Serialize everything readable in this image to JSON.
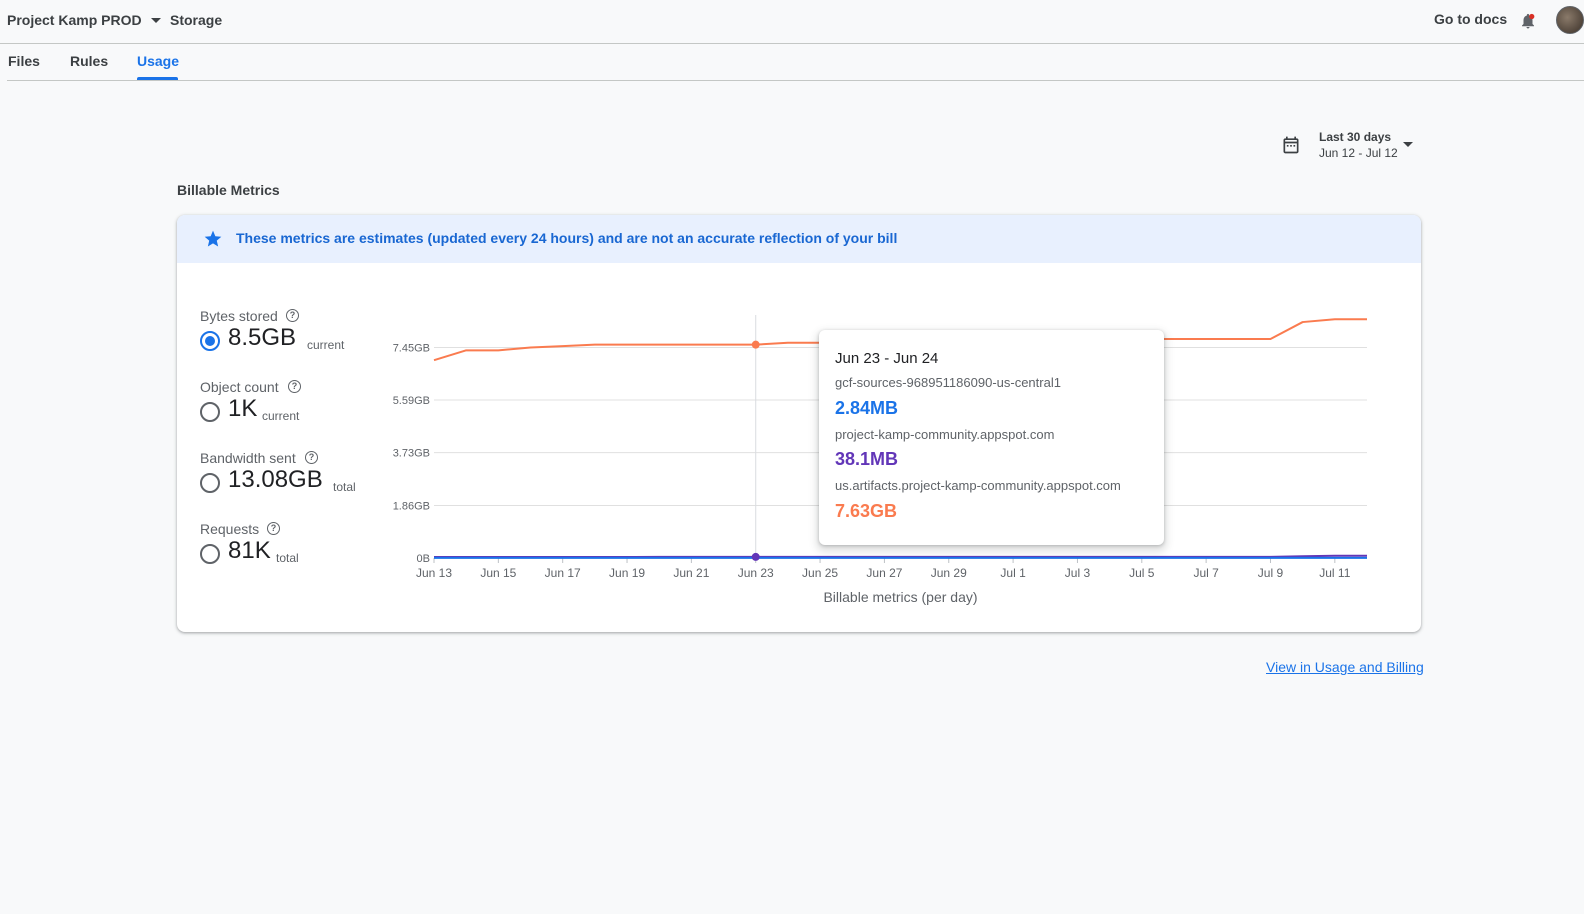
{
  "header": {
    "project_name": "Project Kamp PROD",
    "product": "Storage",
    "docs_link": "Go to docs",
    "icons": [
      "chevron-down-icon",
      "bell-icon",
      "avatar"
    ]
  },
  "tabs": [
    {
      "label": "Files"
    },
    {
      "label": "Rules"
    },
    {
      "label": "Usage",
      "active": true
    }
  ],
  "date_range": {
    "title": "Last 30 days",
    "range": "Jun 12 - Jul 12"
  },
  "section_title": "Billable Metrics",
  "banner": {
    "text": "These metrics are estimates (updated every 24 hours) and are not an accurate reflection of your bill"
  },
  "metrics": [
    {
      "label": "Bytes stored",
      "value": "8.5GB",
      "suffix": "current",
      "selected": true
    },
    {
      "label": "Object count",
      "value": "1K",
      "suffix": "current",
      "selected": false
    },
    {
      "label": "Bandwidth sent",
      "value": "13.08GB",
      "suffix": "total",
      "selected": false
    },
    {
      "label": "Requests",
      "value": "81K",
      "suffix": "total",
      "selected": false
    }
  ],
  "colors": {
    "accent": "#1a73e8",
    "series_orange": "#fa7b4f",
    "series_purple": "#6236b8",
    "series_blue": "#1a73e8"
  },
  "chart_data": {
    "type": "line",
    "xlabel": "Billable metrics (per day)",
    "ylabel": "",
    "y_tick_labels": [
      "0B",
      "1.86GB",
      "3.73GB",
      "5.59GB",
      "7.45GB"
    ],
    "y_ticks_gb": [
      0,
      1.86,
      3.73,
      5.59,
      7.45
    ],
    "ylim_gb": [
      0,
      8.6
    ],
    "x_tick_labels": [
      "Jun 13",
      "Jun 15",
      "Jun 17",
      "Jun 19",
      "Jun 21",
      "Jun 23",
      "Jun 25",
      "Jun 27",
      "Jun 29",
      "Jul 1",
      "Jul 3",
      "Jul 5",
      "Jul 7",
      "Jul 9",
      "Jul 11"
    ],
    "x": [
      "Jun 13",
      "Jun 14",
      "Jun 15",
      "Jun 16",
      "Jun 17",
      "Jun 18",
      "Jun 19",
      "Jun 20",
      "Jun 21",
      "Jun 22",
      "Jun 23",
      "Jun 24",
      "Jun 25",
      "Jun 26",
      "Jun 27",
      "Jun 28",
      "Jun 29",
      "Jun 30",
      "Jul 1",
      "Jul 2",
      "Jul 3",
      "Jul 4",
      "Jul 5",
      "Jul 6",
      "Jul 7",
      "Jul 8",
      "Jul 9",
      "Jul 10",
      "Jul 11",
      "Jul 12"
    ],
    "series": [
      {
        "name": "us.artifacts.project-kamp-community.appspot.com",
        "color": "#fa7b4f",
        "values": [
          7.0,
          7.35,
          7.35,
          7.45,
          7.5,
          7.55,
          7.55,
          7.55,
          7.55,
          7.55,
          7.55,
          7.62,
          7.62,
          7.63,
          7.65,
          7.65,
          7.65,
          7.7,
          7.7,
          7.7,
          7.7,
          7.75,
          7.75,
          7.75,
          7.75,
          7.75,
          7.75,
          8.35,
          8.45,
          8.45
        ]
      },
      {
        "name": "project-kamp-community.appspot.com",
        "color": "#6236b8",
        "values": [
          0.036,
          0.036,
          0.037,
          0.037,
          0.037,
          0.037,
          0.037,
          0.038,
          0.038,
          0.038,
          0.038,
          0.038,
          0.038,
          0.039,
          0.039,
          0.039,
          0.039,
          0.039,
          0.04,
          0.04,
          0.04,
          0.04,
          0.04,
          0.04,
          0.04,
          0.04,
          0.04,
          0.06,
          0.08,
          0.08
        ]
      },
      {
        "name": "gcf-sources-968951186090-us-central1",
        "color": "#1a73e8",
        "values": [
          0.0028,
          0.0028,
          0.0028,
          0.0028,
          0.0028,
          0.0028,
          0.0028,
          0.0028,
          0.0028,
          0.0028,
          0.0028,
          0.0028,
          0.0028,
          0.0028,
          0.0028,
          0.0028,
          0.0028,
          0.0028,
          0.0028,
          0.0028,
          0.0028,
          0.0028,
          0.0028,
          0.0028,
          0.0028,
          0.0028,
          0.0028,
          0.0028,
          0.0028,
          0.0028
        ]
      }
    ],
    "hover_index": 10
  },
  "tooltip": {
    "title": "Jun 23 - Jun 24",
    "rows": [
      {
        "name": "gcf-sources-968951186090-us-central1",
        "value": "2.84MB",
        "color": "#1a73e8"
      },
      {
        "name": "project-kamp-community.appspot.com",
        "value": "38.1MB",
        "color": "#6236b8"
      },
      {
        "name": "us.artifacts.project-kamp-community.appspot.com",
        "value": "7.63GB",
        "color": "#fa7b4f"
      }
    ]
  },
  "footer": {
    "billing_link": "View in Usage and Billing"
  }
}
